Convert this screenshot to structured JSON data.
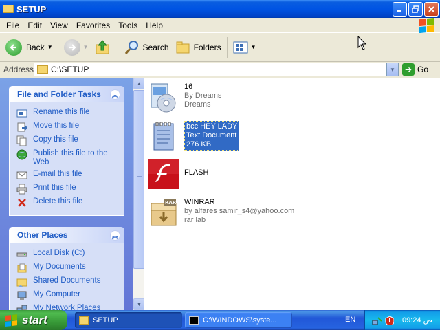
{
  "window": {
    "title": "SETUP"
  },
  "menu": [
    "File",
    "Edit",
    "View",
    "Favorites",
    "Tools",
    "Help"
  ],
  "toolbar": {
    "back": "Back",
    "search": "Search",
    "folders": "Folders"
  },
  "address": {
    "label": "Address",
    "value": "C:\\SETUP",
    "go": "Go"
  },
  "file_tasks": {
    "title": "File and Folder Tasks",
    "items": [
      "Rename this file",
      "Move this file",
      "Copy this file",
      "Publish this file to the Web",
      "E-mail this file",
      "Print this file",
      "Delete this file"
    ]
  },
  "other_places": {
    "title": "Other Places",
    "items": [
      "Local Disk (C:)",
      "My Documents",
      "Shared Documents",
      "My Computer",
      "My Network Places"
    ]
  },
  "files": [
    {
      "name": "16",
      "line2": "By Dreams",
      "line3": "Dreams",
      "icon": "setup-icon",
      "selected": false
    },
    {
      "name": "bcc HEY LADY",
      "line2": "Text Document",
      "line3": "276 KB",
      "icon": "text-document-icon",
      "selected": true
    },
    {
      "name": "FLASH",
      "line2": "",
      "line3": "",
      "icon": "flash-icon",
      "selected": false
    },
    {
      "name": "WINRAR",
      "line2": "by alfares samir_s4@yahoo.com",
      "line3": "rar lab",
      "icon": "winrar-icon",
      "selected": false
    }
  ],
  "taskbar": {
    "start": "start",
    "tasks": [
      "SETUP",
      "C:\\WINDOWS\\syste..."
    ],
    "lang": "EN",
    "time": "09:24 ص"
  },
  "colors": {
    "title_bar": "#0054e3",
    "task_pane": "#6375d6",
    "selection": "#316ac5",
    "start_button": "#3c9a3c"
  }
}
